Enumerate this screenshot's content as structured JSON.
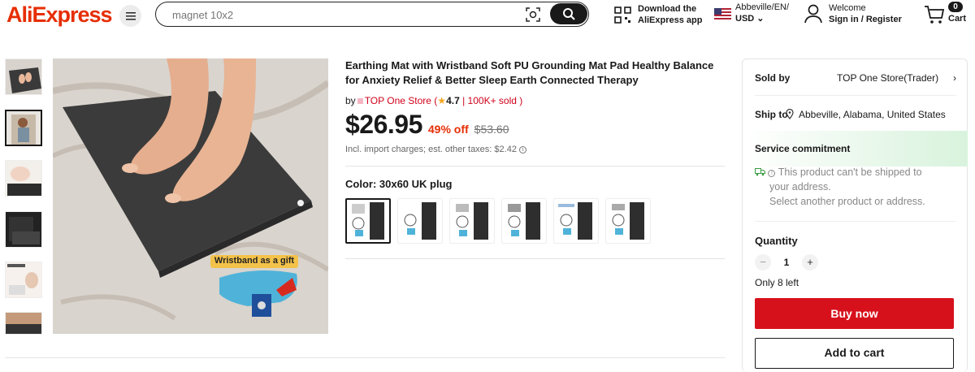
{
  "header": {
    "logo": "AliExpress",
    "search_placeholder": "magnet 10x2",
    "app_download_line1": "Download the",
    "app_download_line2": "AliExpress app",
    "region_line1": "Abbeville/EN/",
    "region_line2": "USD",
    "account_line1": "Welcome",
    "account_line2": "Sign in / Register",
    "cart_count": "0",
    "cart_label": "Cart"
  },
  "product": {
    "title": "Earthing Mat with Wristband Soft PU Grounding Mat Pad Healthy Balance for Anxiety Relief & Better Sleep Earth Connected Therapy",
    "by": "by",
    "store": "TOP One Store",
    "rating_open": "(",
    "rating": "4.7",
    "sold": "| 100K+ sold )",
    "price": "$26.95",
    "discount": "49% off",
    "original_price": "$53.60",
    "tax_note": "Incl. import charges; est. other taxes: $2.42",
    "color_label": "Color: 30x60 UK plug",
    "image_caption": "Wristband as a gift",
    "variant_count": 6
  },
  "panel": {
    "sold_by_label": "Sold by",
    "sold_by_value": "TOP One Store(Trader)",
    "ship_to_label": "Ship to",
    "ship_to_value": "Abbeville, Alabama, United States",
    "service_label": "Service commitment",
    "service_message_1": "This product can't be shipped to",
    "service_message_2": "your address.",
    "service_message_3": "Select another product or address.",
    "quantity_label": "Quantity",
    "quantity_value": "1",
    "minus": "−",
    "plus": "+",
    "stock": "Only 8 left",
    "buy_now": "Buy now",
    "add_to_cart": "Add to cart"
  },
  "colors": {
    "brand": "#e62e04",
    "buy_button": "#d7111b",
    "service_green": "#3a9a42"
  }
}
